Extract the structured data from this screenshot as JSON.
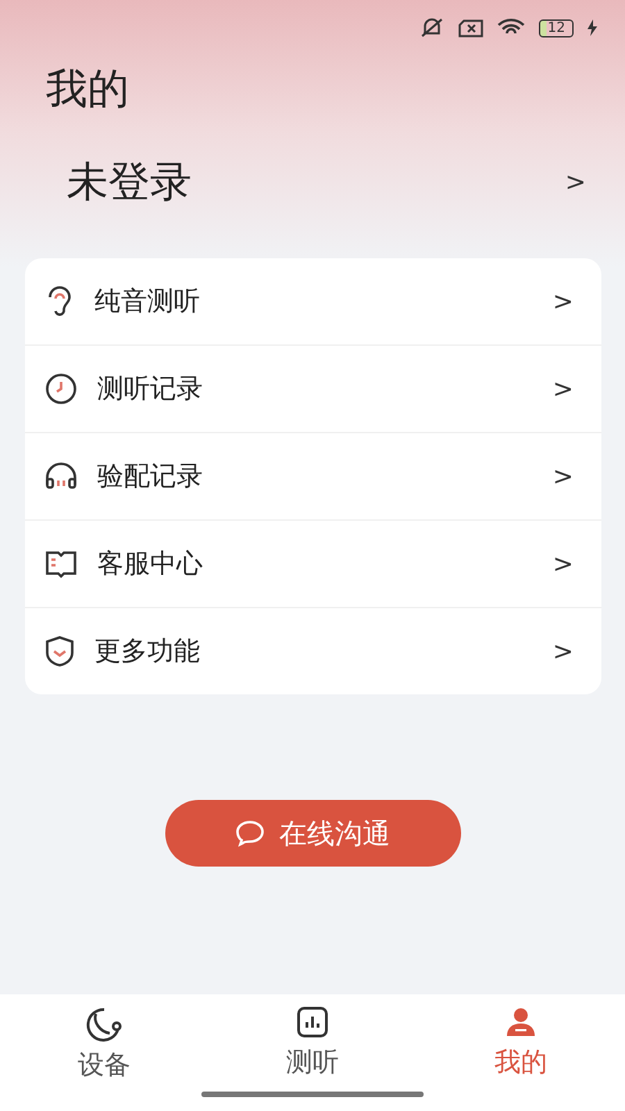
{
  "status_bar": {
    "battery": "12"
  },
  "header": {
    "title": "我的",
    "login": "未登录",
    "chevron": ">"
  },
  "menu": [
    {
      "kind": "ear",
      "label": "纯音测听",
      "chevron": ">"
    },
    {
      "kind": "clock",
      "label": "测听记录",
      "chevron": ">"
    },
    {
      "kind": "headphones",
      "label": "验配记录",
      "chevron": ">"
    },
    {
      "kind": "book",
      "label": "客服中心",
      "chevron": ">"
    },
    {
      "kind": "shield",
      "label": "更多功能",
      "chevron": ">"
    }
  ],
  "chat_button": {
    "label": "在线沟通"
  },
  "tabs": [
    {
      "kind": "device",
      "label": "设备",
      "selected": false
    },
    {
      "kind": "chart",
      "label": "测听",
      "selected": false
    },
    {
      "kind": "person",
      "label": "我的",
      "selected": true
    }
  ]
}
